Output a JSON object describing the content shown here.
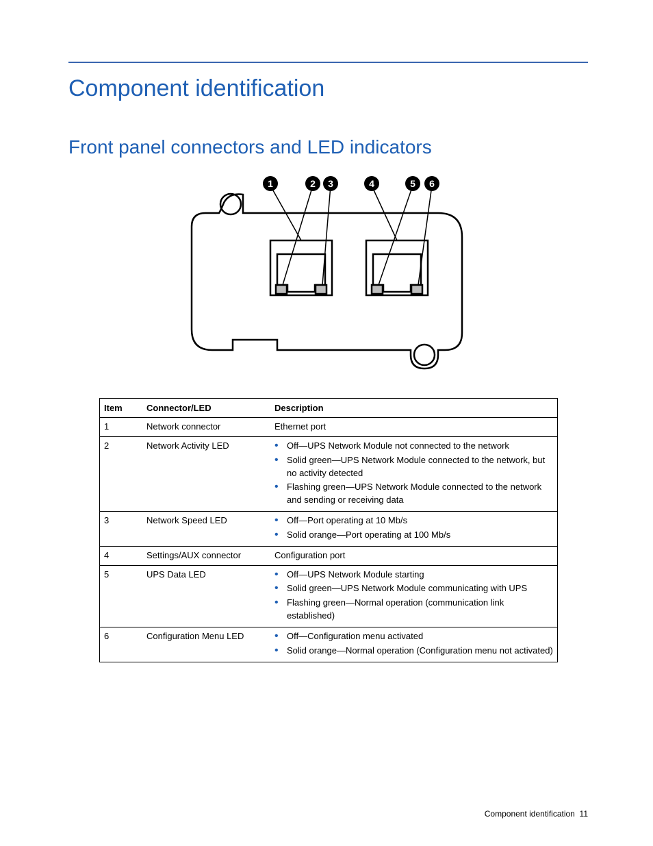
{
  "headings": {
    "h1": "Component identification",
    "h2": "Front panel connectors and LED indicators"
  },
  "callouts": [
    "1",
    "2",
    "3",
    "4",
    "5",
    "6"
  ],
  "table": {
    "headers": [
      "Item",
      "Connector/LED",
      "Description"
    ],
    "rows": [
      {
        "item": "1",
        "name": "Network connector",
        "desc_plain": "Ethernet port"
      },
      {
        "item": "2",
        "name": "Network Activity LED",
        "desc_list": [
          "Off—UPS Network Module not connected to the network",
          "Solid green—UPS Network Module connected to the network, but no activity detected",
          "Flashing green—UPS Network Module connected to the network and sending or receiving data"
        ]
      },
      {
        "item": "3",
        "name": "Network Speed LED",
        "desc_list": [
          "Off—Port operating at 10 Mb/s",
          "Solid orange—Port operating at 100 Mb/s"
        ]
      },
      {
        "item": "4",
        "name": "Settings/AUX connector",
        "desc_plain": "Configuration port"
      },
      {
        "item": "5",
        "name": "UPS Data LED",
        "desc_list": [
          "Off—UPS Network Module starting",
          "Solid green—UPS Network Module communicating with UPS",
          "Flashing green—Normal operation (communication link established)"
        ]
      },
      {
        "item": "6",
        "name": "Configuration Menu LED",
        "desc_list": [
          "Off—Configuration menu activated",
          "Solid orange—Normal operation (Configuration menu not activated)"
        ]
      }
    ]
  },
  "footer": {
    "section": "Component identification",
    "page": "11"
  }
}
